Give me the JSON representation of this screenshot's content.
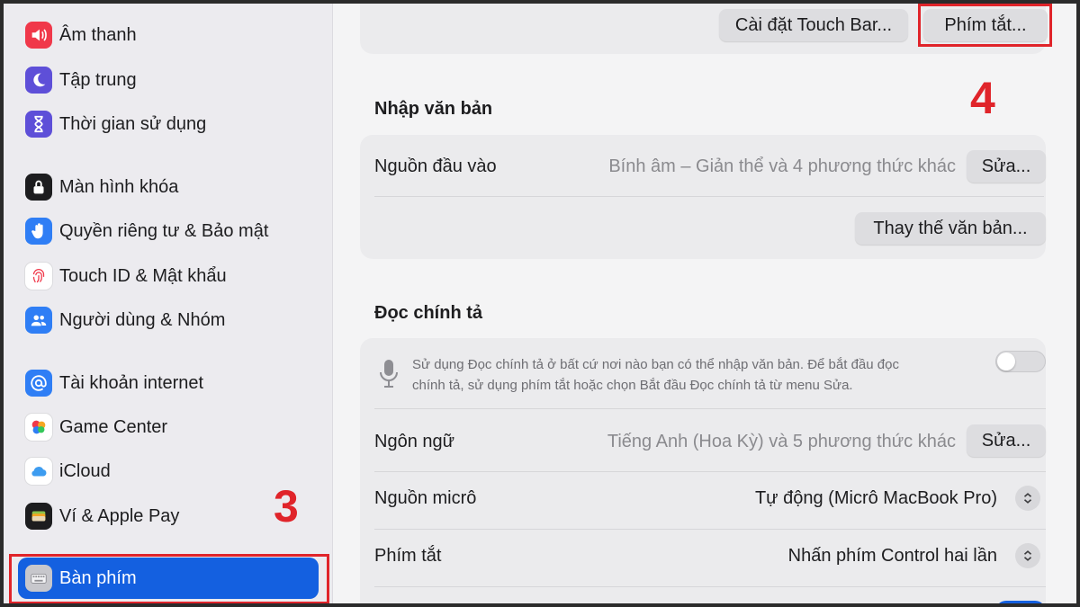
{
  "sidebar": {
    "items": [
      {
        "label": "Âm thanh",
        "icon": "speaker-icon",
        "color": "#f0384a"
      },
      {
        "label": "Tập trung",
        "icon": "moon-icon",
        "color": "#5e4fd8"
      },
      {
        "label": "Thời gian sử dụng",
        "icon": "hourglass-icon",
        "color": "#5e4fd8"
      },
      {
        "label": "Màn hình khóa",
        "icon": "lock-icon",
        "color": "#1d1d1f"
      },
      {
        "label": "Quyền riêng tư & Bảo mật",
        "icon": "hand-icon",
        "color": "#2f7ef5"
      },
      {
        "label": "Touch ID & Mật khẩu",
        "icon": "fingerprint-icon",
        "color": "#ffffff"
      },
      {
        "label": "Người dùng & Nhóm",
        "icon": "users-icon",
        "color": "#2f7ef5"
      },
      {
        "label": "Tài khoản internet",
        "icon": "at-icon",
        "color": "#2f7ef5"
      },
      {
        "label": "Game Center",
        "icon": "game-center-icon",
        "color": "#ffffff"
      },
      {
        "label": "iCloud",
        "icon": "cloud-icon",
        "color": "#ffffff"
      },
      {
        "label": "Ví & Apple Pay",
        "icon": "wallet-icon",
        "color": "#1d1d1f"
      },
      {
        "label": "Bàn phím",
        "icon": "keyboard-icon",
        "color": "#8e8e93"
      }
    ],
    "active_color": "#1460e0"
  },
  "top_card": {
    "touchbar_button": "Cài đặt Touch Bar...",
    "shortcuts_button": "Phím tắt..."
  },
  "text_input": {
    "title": "Nhập văn bản",
    "input_sources_label": "Nguồn đầu vào",
    "input_sources_value": "Bính âm – Giản thể và 4 phương thức khác",
    "edit_button": "Sửa...",
    "text_replacement_button": "Thay thế văn bản..."
  },
  "dictation": {
    "title": "Đọc chính tả",
    "description_line1": "Sử dụng Đọc chính tả ở bất cứ nơi nào bạn có thể nhập văn bản. Để bắt đầu đọc",
    "description_line2": "chính tả, sử dụng phím tắt hoặc chọn Bắt đầu Đọc chính tả từ menu Sửa.",
    "enabled": false,
    "language_label": "Ngôn ngữ",
    "language_value": "Tiếng Anh (Hoa Kỳ) và 5 phương thức khác",
    "language_edit_button": "Sửa...",
    "mic_source_label": "Nguồn micrô",
    "mic_source_value": "Tự động (Micrô MacBook Pro)",
    "shortcut_label": "Phím tắt",
    "shortcut_value": "Nhấn phím Control hai lần"
  },
  "annotations": {
    "step3": "3",
    "step4": "4",
    "highlight_color": "#e0242a"
  }
}
